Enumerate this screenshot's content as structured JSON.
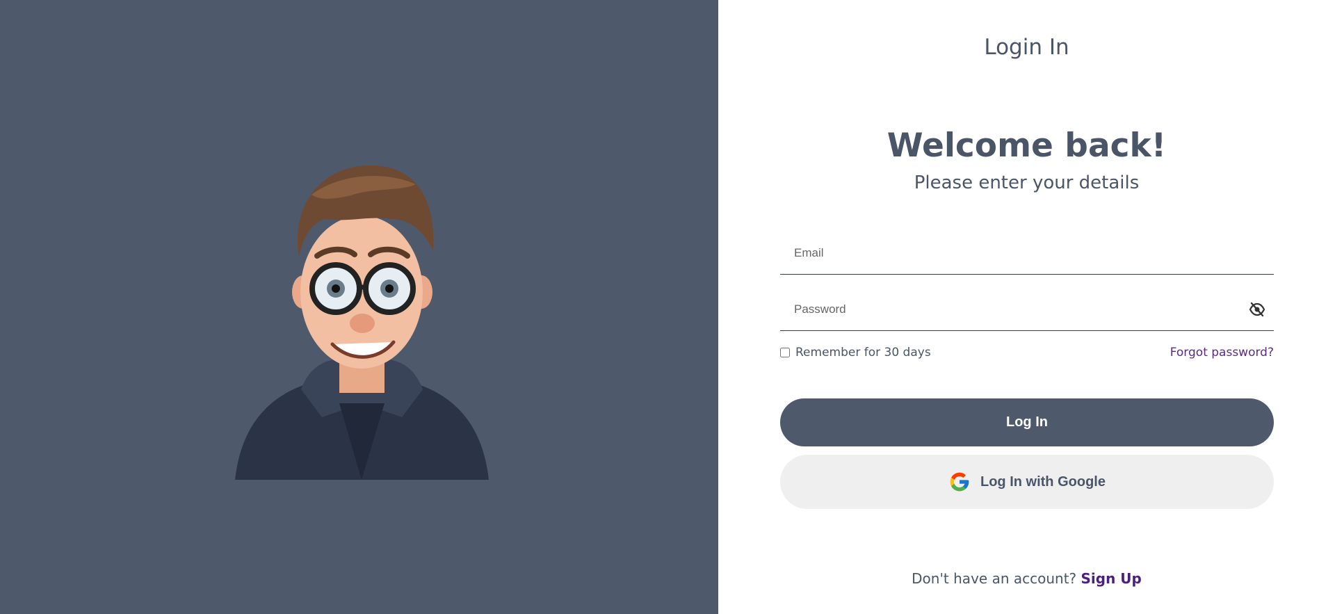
{
  "header": {
    "title": "Login In"
  },
  "hero": {
    "welcome": "Welcome back!",
    "subtitle": "Please enter your details"
  },
  "form": {
    "email": {
      "placeholder": "Email",
      "value": ""
    },
    "password": {
      "placeholder": "Password",
      "value": "",
      "toggle_icon": "eye-slash-icon"
    },
    "remember_label": "Remember for 30 days",
    "remember_checked": false,
    "forgot_label": "Forgot password?",
    "login_label": "Log In",
    "google_label": "Log In with Google",
    "google_icon": "google-icon"
  },
  "footer": {
    "prompt": "Don't have an account?",
    "signup_label": "Sign Up"
  },
  "colors": {
    "panel_bg": "#4e5a6c",
    "text": "#4a5568",
    "link": "#5b2a86",
    "google_btn_bg": "#efefef"
  },
  "illustration": {
    "icon": "cartoon-avatar-with-glasses"
  }
}
